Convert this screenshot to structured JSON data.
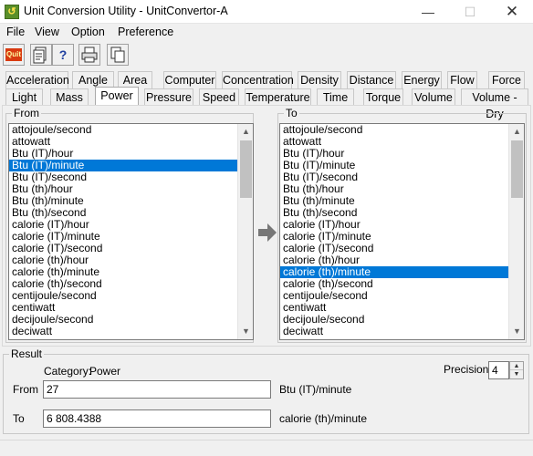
{
  "window": {
    "title": "Unit Conversion Utility - UnitConvertor-A"
  },
  "menu": [
    "File",
    "View",
    "Option",
    "Preference"
  ],
  "toolbar": {
    "quit_label": "Quit",
    "report_icon": "report-icon",
    "help_label": "?",
    "print_icon": "printer-icon",
    "copy_icon": "copy-icon"
  },
  "tabs_row1": [
    "Acceleration",
    "Angle",
    "Area",
    "Computer",
    "Concentration",
    "Density",
    "Distance",
    "Energy",
    "Flow",
    "Force"
  ],
  "tabs_row2": [
    "Light",
    "Mass",
    "Power",
    "Pressure",
    "Speed",
    "Temperature",
    "Time",
    "Torque",
    "Volume",
    "Volume - Dry"
  ],
  "active_tab": "Power",
  "from_panel": {
    "label": "From",
    "items": [
      "attojoule/second",
      "attowatt",
      "Btu (IT)/hour",
      "Btu (IT)/minute",
      "Btu (IT)/second",
      "Btu (th)/hour",
      "Btu (th)/minute",
      "Btu (th)/second",
      "calorie (IT)/hour",
      "calorie (IT)/minute",
      "calorie (IT)/second",
      "calorie (th)/hour",
      "calorie (th)/minute",
      "calorie (th)/second",
      "centijoule/second",
      "centiwatt",
      "decijoule/second",
      "deciwatt"
    ],
    "selected": "Btu (IT)/minute"
  },
  "to_panel": {
    "label": "To",
    "items": [
      "attojoule/second",
      "attowatt",
      "Btu (IT)/hour",
      "Btu (IT)/minute",
      "Btu (IT)/second",
      "Btu (th)/hour",
      "Btu (th)/minute",
      "Btu (th)/second",
      "calorie (IT)/hour",
      "calorie (IT)/minute",
      "calorie (IT)/second",
      "calorie (th)/hour",
      "calorie (th)/minute",
      "calorie (th)/second",
      "centijoule/second",
      "centiwatt",
      "decijoule/second",
      "deciwatt"
    ],
    "selected": "calorie (th)/minute"
  },
  "result": {
    "label": "Result",
    "category_label": "Category:",
    "category_value": "Power",
    "precision_label": "Precision",
    "precision_value": "4",
    "from_label": "From",
    "from_value": "27",
    "from_unit": "Btu (IT)/minute",
    "to_label": "To",
    "to_value": "6 808.4388",
    "to_unit": "calorie (th)/minute"
  },
  "colors": {
    "selection": "#0078d7",
    "window_bg": "#f0f0f0"
  }
}
